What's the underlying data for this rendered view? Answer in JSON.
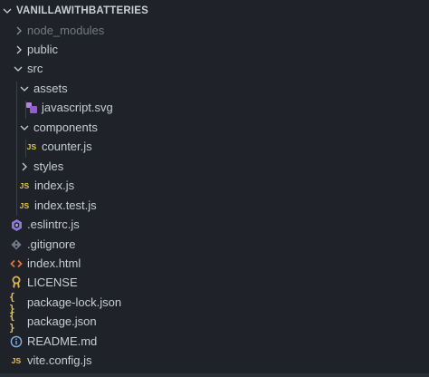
{
  "explorer": {
    "root_label": "VANILLAWITHBATTERIES",
    "items": [
      {
        "label": "node_modules",
        "kind": "folder",
        "state": "collapsed",
        "dimmed": true
      },
      {
        "label": "public",
        "kind": "folder",
        "state": "collapsed"
      },
      {
        "label": "src",
        "kind": "folder",
        "state": "expanded"
      },
      {
        "label": "assets",
        "kind": "folder",
        "state": "expanded"
      },
      {
        "label": "javascript.svg",
        "kind": "file",
        "icon": "svg-file-icon"
      },
      {
        "label": "components",
        "kind": "folder",
        "state": "expanded"
      },
      {
        "label": "counter.js",
        "kind": "file",
        "icon": "js-file-icon"
      },
      {
        "label": "styles",
        "kind": "folder",
        "state": "collapsed"
      },
      {
        "label": "index.js",
        "kind": "file",
        "icon": "js-file-icon"
      },
      {
        "label": "index.test.js",
        "kind": "file",
        "icon": "js-file-icon"
      },
      {
        "label": ".eslintrc.js",
        "kind": "file",
        "icon": "eslint-icon"
      },
      {
        "label": ".gitignore",
        "kind": "file",
        "icon": "git-icon"
      },
      {
        "label": "index.html",
        "kind": "file",
        "icon": "html-icon"
      },
      {
        "label": "LICENSE",
        "kind": "file",
        "icon": "license-icon"
      },
      {
        "label": "package-lock.json",
        "kind": "file",
        "icon": "json-icon"
      },
      {
        "label": "package.json",
        "kind": "file",
        "icon": "json-icon"
      },
      {
        "label": "README.md",
        "kind": "file",
        "icon": "info-icon"
      },
      {
        "label": "vite.config.js",
        "kind": "file",
        "icon": "js-file-icon"
      }
    ],
    "icon_glyphs": {
      "js": "JS",
      "json": "{ }"
    }
  },
  "colors": {
    "background": "#1f2229",
    "text": "#c7ccd6",
    "dim_text": "#737986",
    "js_yellow": "#e8c84a",
    "eslint_purple": "#8f7bd6",
    "git_gray": "#7e8694",
    "html_orange": "#e2733b",
    "license_yellow": "#d9b548",
    "json_yellow": "#e5c15a",
    "info_blue": "#7fb2e6",
    "svg_purple": "#b67fe0"
  }
}
